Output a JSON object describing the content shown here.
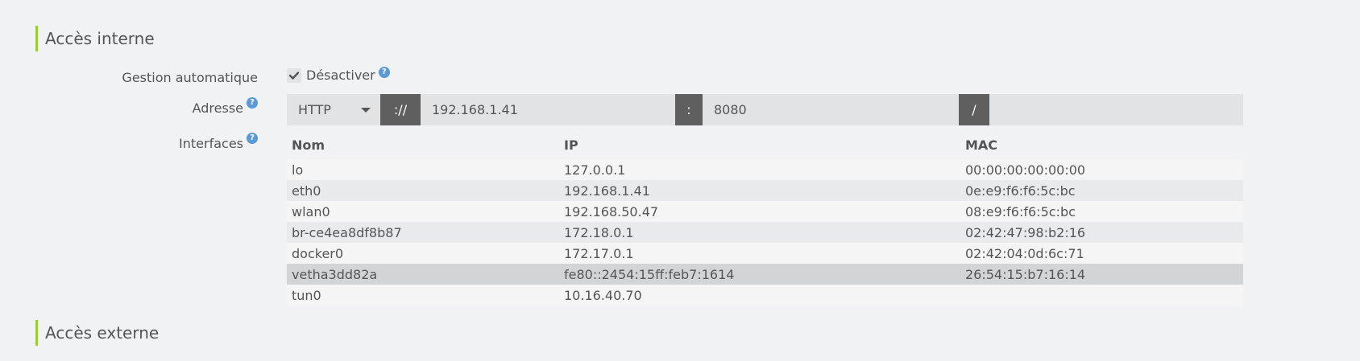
{
  "internal_section": {
    "title": "Accès interne"
  },
  "auto_manage": {
    "label": "Gestion automatique",
    "checkbox_label": "Désactiver",
    "checked": true
  },
  "address": {
    "label": "Adresse",
    "protocol": "HTTP",
    "scheme_sep": "://",
    "host": "192.168.1.41",
    "port_sep": ":",
    "port": "8080",
    "path_sep": "/",
    "path": ""
  },
  "interfaces": {
    "label": "Interfaces",
    "columns": [
      "Nom",
      "IP",
      "MAC"
    ],
    "rows": [
      {
        "name": "lo",
        "ip": "127.0.0.1",
        "mac": "00:00:00:00:00:00"
      },
      {
        "name": "eth0",
        "ip": "192.168.1.41",
        "mac": "0e:e9:f6:f6:5c:bc"
      },
      {
        "name": "wlan0",
        "ip": "192.168.50.47",
        "mac": "08:e9:f6:f6:5c:bc"
      },
      {
        "name": "br-ce4ea8df8b87",
        "ip": "172.18.0.1",
        "mac": "02:42:47:98:b2:16"
      },
      {
        "name": "docker0",
        "ip": "172.17.0.1",
        "mac": "02:42:04:0d:6c:71"
      },
      {
        "name": "vetha3dd82a",
        "ip": "fe80::2454:15ff:feb7:1614",
        "mac": "26:54:15:b7:16:14"
      },
      {
        "name": "tun0",
        "ip": "10.16.40.70",
        "mac": ""
      }
    ],
    "highlighted_row": 5
  },
  "external_section": {
    "title": "Accès externe"
  },
  "colors": {
    "accent": "#9acd32",
    "addon": "#5f5f5f",
    "help": "#5b9bd5"
  },
  "icons": {
    "help": "question-circle-icon",
    "check": "check-icon",
    "caret": "caret-down-icon"
  }
}
